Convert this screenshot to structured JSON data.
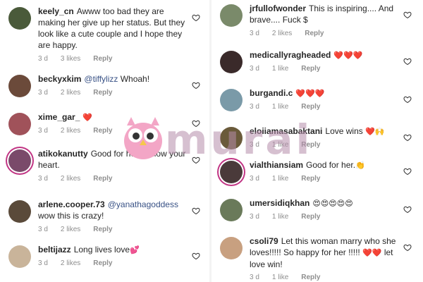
{
  "colors": {
    "text": "#262626",
    "meta": "#8e8e8e",
    "mention": "#385185",
    "heart": "#ed4956",
    "ring": "#c13584"
  },
  "left_column": [
    {
      "username": "keely_cn",
      "parts": [
        {
          "t": "text",
          "v": "Awww too bad they are making her give up her status. But they look like a cute couple and I hope they are happy."
        }
      ],
      "time": "3 d",
      "likes": "3 likes",
      "reply": "Reply"
    },
    {
      "username": "beckyxkim",
      "parts": [
        {
          "t": "mention",
          "v": "@tiffylizz"
        },
        {
          "t": "text",
          "v": " Whoah!"
        }
      ],
      "time": "3 d",
      "likes": "2 likes",
      "reply": "Reply"
    },
    {
      "username": "xime_gar_",
      "parts": [
        {
          "t": "emoji",
          "v": "❤️"
        }
      ],
      "time": "3 d",
      "likes": "2 likes",
      "reply": "Reply"
    },
    {
      "username": "atikokanutty",
      "parts": [
        {
          "t": "text",
          "v": "Good for her. Follow your heart."
        }
      ],
      "time": "3 d",
      "likes": "2 likes",
      "reply": "Reply"
    },
    {
      "username": "arlene.cooper.73",
      "parts": [
        {
          "t": "mention",
          "v": "@yanathagoddess"
        },
        {
          "t": "text",
          "v": " wow this is crazy!"
        }
      ],
      "time": "3 d",
      "likes": "2 likes",
      "reply": "Reply"
    },
    {
      "username": "beltijazz",
      "parts": [
        {
          "t": "text",
          "v": "Long lives love"
        },
        {
          "t": "emoji",
          "v": "💕"
        }
      ],
      "time": "3 d",
      "likes": "2 likes",
      "reply": "Reply"
    }
  ],
  "right_column": [
    {
      "username": "jrfullofwonder",
      "parts": [
        {
          "t": "text",
          "v": "This is inspiring.... And brave.... Fuck $"
        }
      ],
      "time": "3 d",
      "likes": "2 likes",
      "reply": "Reply"
    },
    {
      "username": "medicallyragheaded",
      "parts": [
        {
          "t": "emoji",
          "v": "❤️❤️❤️"
        }
      ],
      "time": "3 d",
      "likes": "1 like",
      "reply": "Reply"
    },
    {
      "username": "burgandi.c",
      "parts": [
        {
          "t": "emoji",
          "v": "❤️❤️❤️"
        }
      ],
      "time": "3 d",
      "likes": "1 like",
      "reply": "Reply"
    },
    {
      "username": "eloiiamasabaktani",
      "parts": [
        {
          "t": "text",
          "v": "Love wins "
        },
        {
          "t": "emoji",
          "v": "❤️🙌"
        }
      ],
      "time": "3 d",
      "likes": "1 like",
      "reply": "Reply"
    },
    {
      "username": "vialthiansiam",
      "parts": [
        {
          "t": "text",
          "v": "Good for her."
        },
        {
          "t": "emoji",
          "v": "👏"
        }
      ],
      "time": "3 d",
      "likes": "1 like",
      "reply": "Reply"
    },
    {
      "username": "umersidiqkhan",
      "parts": [
        {
          "t": "emoji",
          "v": "😍😍😍😍😍"
        }
      ],
      "time": "3 d",
      "likes": "1 like",
      "reply": "Reply"
    },
    {
      "username": "csoli79",
      "parts": [
        {
          "t": "text",
          "v": "Let this woman marry who she loves!!!!! So happy for her !!!!! "
        },
        {
          "t": "emoji",
          "v": "❤️❤️"
        },
        {
          "t": "text",
          "v": " let love win!"
        }
      ],
      "time": "3 d",
      "likes": "1 like",
      "reply": "Reply"
    }
  ],
  "watermark": {
    "text": "murai"
  }
}
